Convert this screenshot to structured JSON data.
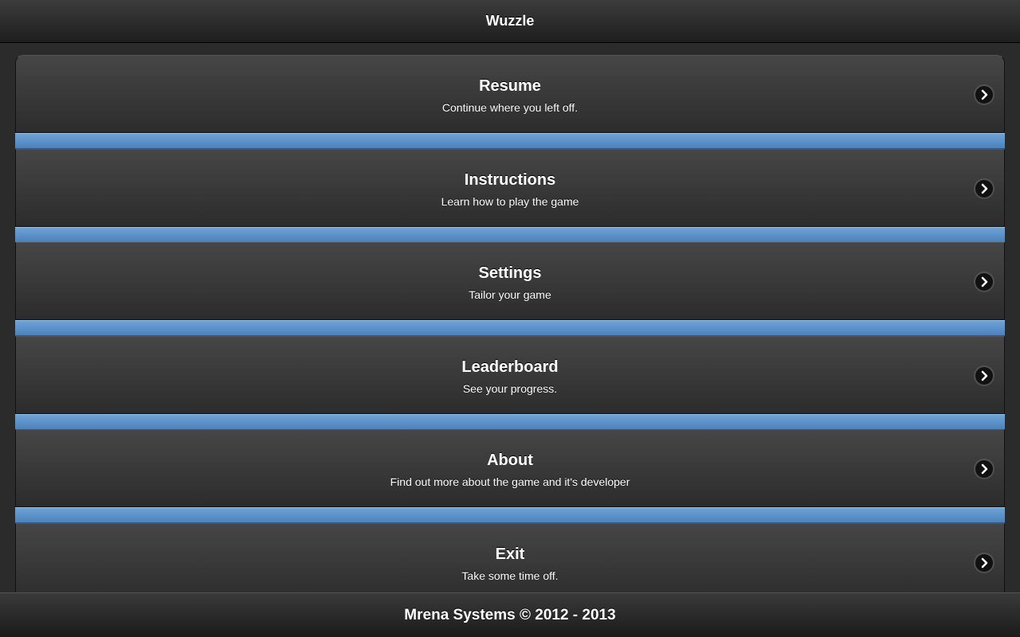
{
  "header": {
    "title": "Wuzzle"
  },
  "menu": {
    "items": [
      {
        "title": "Resume",
        "subtitle": "Continue where you left off."
      },
      {
        "title": "Instructions",
        "subtitle": "Learn how to play the game"
      },
      {
        "title": "Settings",
        "subtitle": "Tailor your game"
      },
      {
        "title": "Leaderboard",
        "subtitle": "See your progress."
      },
      {
        "title": "About",
        "subtitle": "Find out more about the game and it's developer"
      },
      {
        "title": "Exit",
        "subtitle": "Take some time off."
      }
    ],
    "arrow_icon": "chevron-right-icon",
    "divider_color": "#5a92c9"
  },
  "footer": {
    "text": "Mrena Systems © 2012 - 2013"
  }
}
